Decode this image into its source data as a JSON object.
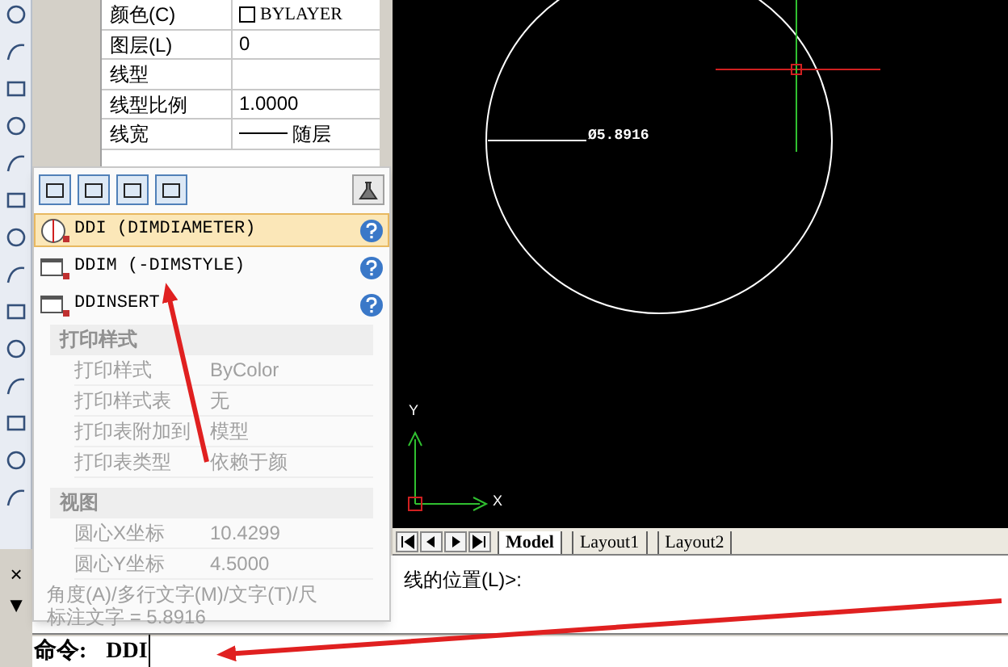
{
  "properties": [
    {
      "label": "颜色(C)",
      "value": "BYLAYER",
      "kind": "color"
    },
    {
      "label": "图层(L)",
      "value": "0",
      "kind": "text"
    },
    {
      "label": "线型",
      "kind": "text"
    },
    {
      "label": "线型比例",
      "value": "1.0000",
      "kind": "text"
    },
    {
      "label": "线宽",
      "value": "随层",
      "kind": "lineweight"
    }
  ],
  "autocomplete": {
    "items": [
      {
        "command": "DDI (DIMDIAMETER)",
        "kind": "dimension",
        "selected": true
      },
      {
        "command": "DDIM (-DIMSTYLE)",
        "kind": "window",
        "selected": false
      },
      {
        "command": "DDINSERT",
        "kind": "window",
        "selected": false
      }
    ],
    "faded_sections": [
      {
        "title": "打印样式",
        "rows": [
          {
            "label": "打印样式",
            "value": "ByColor"
          },
          {
            "label": "打印样式表",
            "value": "无"
          },
          {
            "label": "打印表附加到",
            "value": "模型"
          },
          {
            "label": "打印表类型",
            "value": "依赖于颜"
          }
        ]
      },
      {
        "title": "视图",
        "rows": [
          {
            "label": "圆心X坐标",
            "value": "10.4299"
          },
          {
            "label": "圆心Y坐标",
            "value": "4.5000"
          }
        ]
      }
    ],
    "faded_history": [
      "角度(A)/多行文字(M)/文字(T)/尺",
      "标注文字 = 5.8916"
    ]
  },
  "canvas": {
    "dimension_text": "Ø5.8916",
    "ucs_y": "Y",
    "ucs_x": "X"
  },
  "layout_tabs": [
    {
      "label": "Model",
      "selected": true
    },
    {
      "label": "Layout1",
      "selected": false
    },
    {
      "label": "Layout2",
      "selected": false
    }
  ],
  "command_history": [
    "线的位置(L)>:"
  ],
  "command_line": {
    "prompt": "命令:",
    "value": "DDI"
  },
  "side_buttons": [
    "×",
    "▼"
  ]
}
